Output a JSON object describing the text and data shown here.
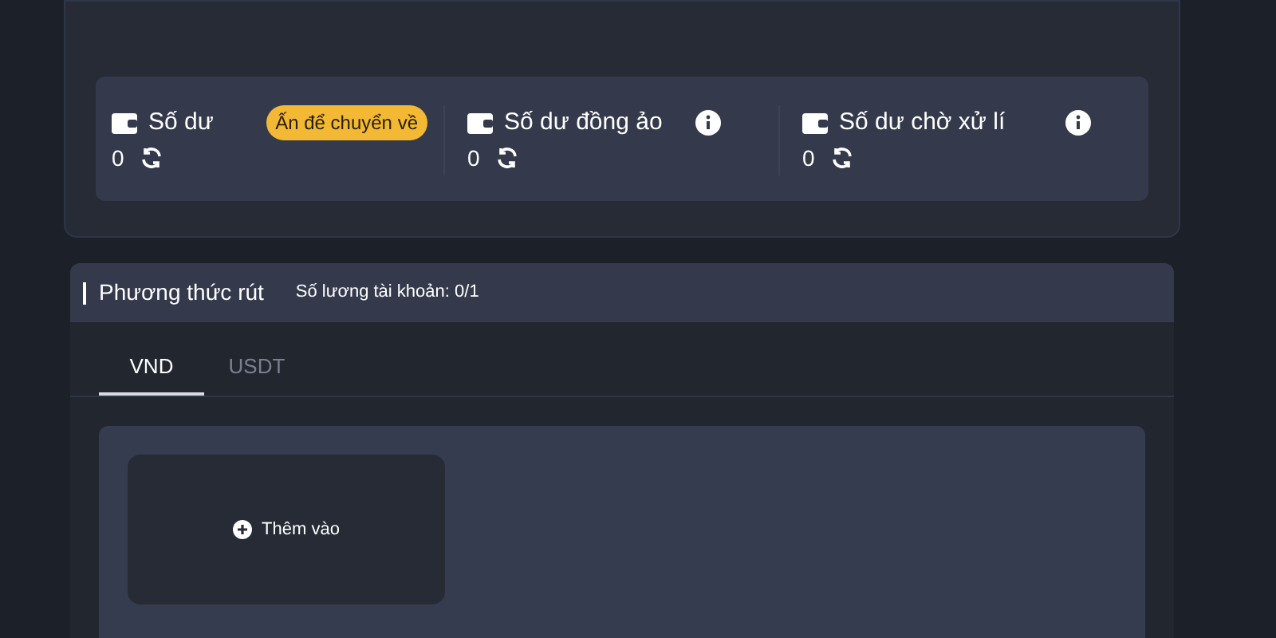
{
  "balances": [
    {
      "label": "Số dư",
      "value": "0",
      "action": "Ấn để chuyển về"
    },
    {
      "label": "Số dư đồng ảo",
      "value": "0",
      "info": true
    },
    {
      "label": "Số dư chờ xử lí",
      "value": "0",
      "info": true
    }
  ],
  "withdraw": {
    "title": "Phương thức rút",
    "count_label": "Số lương tài khoản:",
    "count": "0/1",
    "tabs": [
      {
        "label": "VND",
        "selected": true
      },
      {
        "label": "USDT",
        "selected": false
      }
    ],
    "add_label": "Thêm vào"
  }
}
